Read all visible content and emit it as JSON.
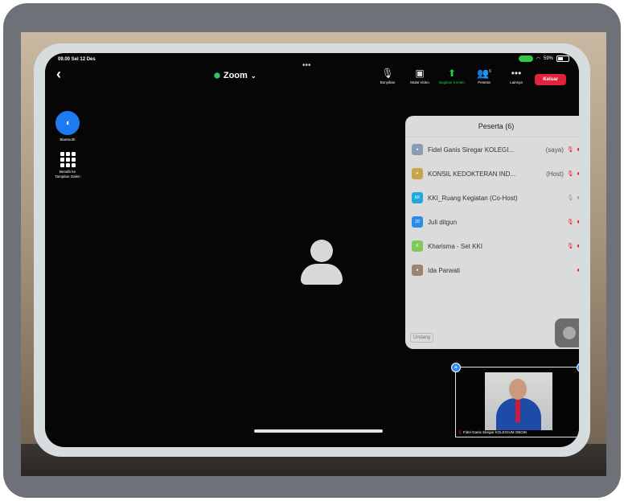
{
  "status": {
    "time_date": "09.00  Sel 12 Des",
    "battery": "59%"
  },
  "meeting": {
    "title": "Zoom",
    "leave_label": "Keluar"
  },
  "toolbar": [
    {
      "label": "Bunyikan",
      "icon": "mic-muted-icon"
    },
    {
      "label": "Mulai Video",
      "icon": "video-off-icon"
    },
    {
      "label": "Bagikan Konten",
      "icon": "share-content-icon"
    },
    {
      "label": "Peserta",
      "icon": "participants-icon",
      "badge": "6"
    },
    {
      "label": "Lainnya",
      "icon": "more-icon"
    }
  ],
  "sidebar": {
    "bluetooth_label": "Bluetooth",
    "gallery_label": "Beralih ke Tampilan Galeri"
  },
  "participants_panel": {
    "title": "Peserta (6)",
    "invite_label": "Undang",
    "rows": [
      {
        "name": "Fidel Ganis Siregar KOLEGI...",
        "tag": "(saya)",
        "avatar": "photo",
        "mic": "muted",
        "cam": "off"
      },
      {
        "name": "KONSIL KEDOKTERAN IND...",
        "tag": "(Host)",
        "avatar": "emblem",
        "mic": "muted",
        "cam": "off"
      },
      {
        "name": "KKI_Ruang Kegiatan (Co-Host)",
        "tag": "",
        "avatar": "KK",
        "mic": "gray",
        "cam": "gray"
      },
      {
        "name": "Juli ditgun",
        "tag": "",
        "avatar": "JD",
        "mic": "muted",
        "cam": "off"
      },
      {
        "name": "Kharisma - Set KKI",
        "tag": "",
        "avatar": "K",
        "mic": "muted",
        "cam": "off"
      },
      {
        "name": "Ida Parwati",
        "tag": "",
        "avatar": "photo",
        "mic": "none",
        "cam": "off"
      }
    ]
  },
  "self_view": {
    "name": "Fidel Ganis Siregar KOLEGIUM OBGIN"
  },
  "colors": {
    "leave": "#e0223a",
    "bluetooth": "#1d7af2",
    "share_green": "#1fd14a"
  }
}
